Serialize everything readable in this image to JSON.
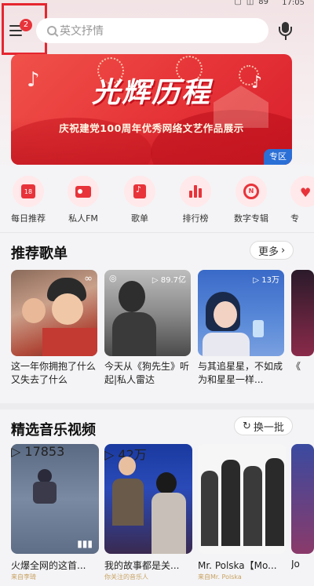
{
  "status_bar": {
    "time": "17:05",
    "battery": "89"
  },
  "header": {
    "menu_badge": "2",
    "search_placeholder": "英文抒情"
  },
  "banner": {
    "title": "光辉历程",
    "subtitle": "庆祝建党100周年优秀网络文艺作品展示",
    "tag": "专区"
  },
  "shortcuts": [
    {
      "label": "每日推荐",
      "icon": "calendar-icon",
      "icon_text": "18"
    },
    {
      "label": "私人FM",
      "icon": "radio-icon"
    },
    {
      "label": "歌单",
      "icon": "playlist-icon"
    },
    {
      "label": "排行榜",
      "icon": "chart-icon"
    },
    {
      "label": "数字专辑",
      "icon": "album-icon"
    },
    {
      "label": "专",
      "icon": "heart-icon"
    }
  ],
  "playlists": {
    "title": "推荐歌单",
    "more_label": "更多",
    "items": [
      {
        "title": "这一年你拥抱了什么 又失去了什么",
        "count": ""
      },
      {
        "title": "今天从《狗先生》听起|私人雷达",
        "count": "89.7亿"
      },
      {
        "title": "与其追星星，不如成为和星星一样...",
        "count": "13万"
      },
      {
        "title": "《",
        "count": ""
      }
    ]
  },
  "videos": {
    "title": "精选音乐视频",
    "refresh_label": "换一批",
    "items": [
      {
        "title": "火爆全网的这首...",
        "sub": "来自李琦",
        "count": "17853"
      },
      {
        "title": "我的故事都是关...",
        "sub": "你关注的音乐人",
        "count": "42万"
      },
      {
        "title": "Mr. Polska【Mo...",
        "sub": "来自Mr. Polska",
        "count": ""
      },
      {
        "title": "Jo",
        "sub": "",
        "count": ""
      }
    ]
  },
  "colors": {
    "accent": "#e8333a",
    "badge": "#e8333a",
    "tag_blue": "#2a6fd6"
  }
}
